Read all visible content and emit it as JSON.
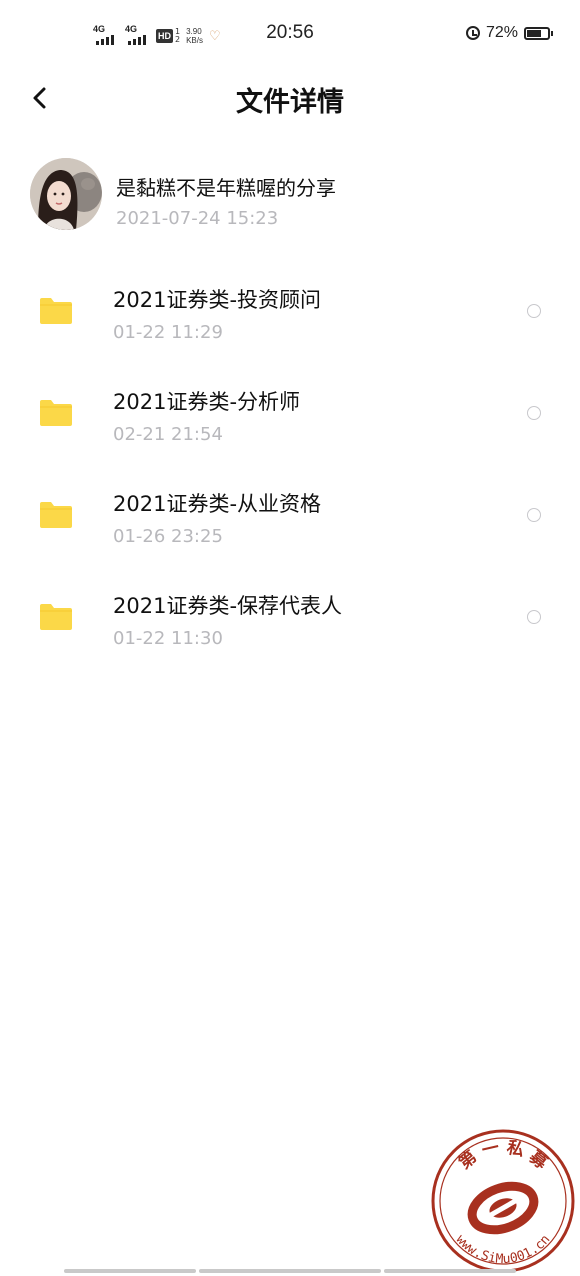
{
  "status_bar": {
    "net1": "4G",
    "net2": "4G",
    "hd": "HD",
    "hd_sub_1": "1",
    "hd_sub_2": "2",
    "speed_value": "3.90",
    "speed_unit": "KB/s",
    "time": "20:56",
    "battery_percent": "72%",
    "battery_level": 0.72
  },
  "header": {
    "title": "文件详情"
  },
  "sharer": {
    "name": "是黏糕不是年糕喔的分享",
    "datetime": "2021-07-24  15:23"
  },
  "files": [
    {
      "name": "2021证券类-投资顾问",
      "time": "01-22  11:29"
    },
    {
      "name": "2021证券类-分析师",
      "time": "02-21  21:54"
    },
    {
      "name": "2021证券类-从业资格",
      "time": "01-26  23:25"
    },
    {
      "name": "2021证券类-保荐代表人",
      "time": "01-22  11:30"
    }
  ],
  "watermark": {
    "top_text": "第 一 私 募",
    "bottom_text": "www.SiMu001.cn"
  },
  "colors": {
    "folder": "#fbd848",
    "muted_text": "#b8b8bc",
    "watermark_red": "#a8301f"
  },
  "icons": {
    "back": "chevron-left-icon",
    "folder": "folder-icon",
    "select": "radio-circle-icon"
  }
}
